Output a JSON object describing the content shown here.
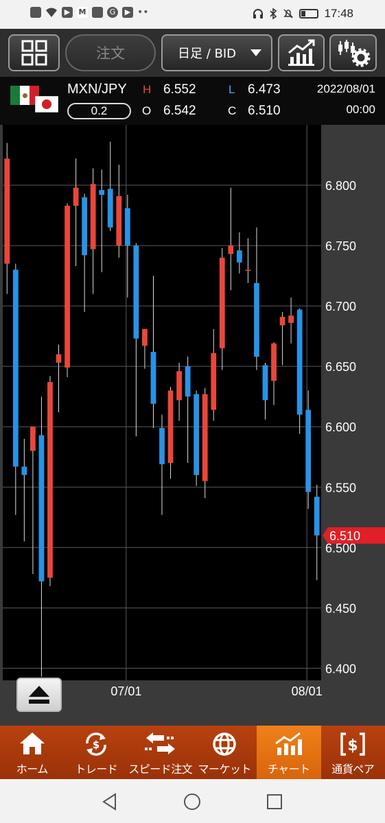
{
  "status_bar": {
    "time": "17:48",
    "icons": [
      "notification-icons",
      "headphones-icon",
      "bluetooth-icon",
      "mute-icon",
      "battery-icon"
    ]
  },
  "toolbar": {
    "grid_icon": "grid-menu-icon",
    "order_label": "注文",
    "period_label": "日足 / BID",
    "chart_icon": "chart-type-icon",
    "settings_icon": "indicator-settings-icon"
  },
  "info": {
    "pair": "MXN/JPY",
    "spread": "0.2",
    "high_label": "H",
    "high": "6.552",
    "open_label": "O",
    "open": "6.542",
    "low_label": "L",
    "low": "6.473",
    "close_label": "C",
    "close": "6.510",
    "date": "2022/08/01",
    "time": "00:00"
  },
  "colors": {
    "up": "#e9473b",
    "down": "#2893e6",
    "high_label": "#e9473b",
    "low_label": "#4aa8f0",
    "current_price": "#e11f26",
    "nav_bg": "#a8390c",
    "nav_active": "#ec7516"
  },
  "chart_data": {
    "type": "candlestick",
    "y_ticks": [
      "6.800",
      "6.750",
      "6.700",
      "6.650",
      "6.600",
      "6.550",
      "6.500",
      "6.450",
      "6.400"
    ],
    "ylim": [
      6.39,
      6.85
    ],
    "x_ticks": [
      {
        "label": "07/01",
        "index": 14
      },
      {
        "label": "08/01",
        "index": 35
      }
    ],
    "current_price": "6.510",
    "candles": [
      {
        "o": 6.735,
        "h": 6.835,
        "l": 6.71,
        "c": 6.822
      },
      {
        "o": 6.73,
        "h": 6.735,
        "l": 6.527,
        "c": 6.567
      },
      {
        "o": 6.567,
        "h": 6.59,
        "l": 6.505,
        "c": 6.56
      },
      {
        "o": 6.58,
        "h": 6.6,
        "l": 6.478,
        "c": 6.6
      },
      {
        "o": 6.593,
        "h": 6.625,
        "l": 6.393,
        "c": 6.472
      },
      {
        "o": 6.475,
        "h": 6.642,
        "l": 6.468,
        "c": 6.637
      },
      {
        "o": 6.653,
        "h": 6.668,
        "l": 6.612,
        "c": 6.66
      },
      {
        "o": 6.649,
        "h": 6.785,
        "l": 6.641,
        "c": 6.783
      },
      {
        "o": 6.783,
        "h": 6.822,
        "l": 6.733,
        "c": 6.798
      },
      {
        "o": 6.79,
        "h": 6.793,
        "l": 6.695,
        "c": 6.742
      },
      {
        "o": 6.747,
        "h": 6.814,
        "l": 6.71,
        "c": 6.801
      },
      {
        "o": 6.796,
        "h": 6.813,
        "l": 6.728,
        "c": 6.792
      },
      {
        "o": 6.797,
        "h": 6.836,
        "l": 6.762,
        "c": 6.765
      },
      {
        "o": 6.75,
        "h": 6.817,
        "l": 6.74,
        "c": 6.791
      },
      {
        "o": 6.781,
        "h": 6.792,
        "l": 6.707,
        "c": 6.75
      },
      {
        "o": 6.75,
        "h": 6.752,
        "l": 6.592,
        "c": 6.673
      },
      {
        "o": 6.667,
        "h": 6.68,
        "l": 6.648,
        "c": 6.681
      },
      {
        "o": 6.662,
        "h": 6.725,
        "l": 6.599,
        "c": 6.619
      },
      {
        "o": 6.599,
        "h": 6.61,
        "l": 6.527,
        "c": 6.569
      },
      {
        "o": 6.57,
        "h": 6.633,
        "l": 6.557,
        "c": 6.63
      },
      {
        "o": 6.622,
        "h": 6.653,
        "l": 6.605,
        "c": 6.646
      },
      {
        "o": 6.65,
        "h": 6.658,
        "l": 6.57,
        "c": 6.625
      },
      {
        "o": 6.627,
        "h": 6.63,
        "l": 6.551,
        "c": 6.56
      },
      {
        "o": 6.555,
        "h": 6.632,
        "l": 6.541,
        "c": 6.627
      },
      {
        "o": 6.614,
        "h": 6.681,
        "l": 6.605,
        "c": 6.661
      },
      {
        "o": 6.665,
        "h": 6.748,
        "l": 6.647,
        "c": 6.74
      },
      {
        "o": 6.743,
        "h": 6.798,
        "l": 6.713,
        "c": 6.75
      },
      {
        "o": 6.746,
        "h": 6.761,
        "l": 6.727,
        "c": 6.736
      },
      {
        "o": 6.73,
        "h": 6.756,
        "l": 6.719,
        "c": 6.73
      },
      {
        "o": 6.719,
        "h": 6.765,
        "l": 6.647,
        "c": 6.658
      },
      {
        "o": 6.651,
        "h": 6.653,
        "l": 6.606,
        "c": 6.622
      },
      {
        "o": 6.638,
        "h": 6.67,
        "l": 6.618,
        "c": 6.669
      },
      {
        "o": 6.684,
        "h": 6.695,
        "l": 6.651,
        "c": 6.691
      },
      {
        "o": 6.686,
        "h": 6.707,
        "l": 6.669,
        "c": 6.692
      },
      {
        "o": 6.697,
        "h": 6.698,
        "l": 6.594,
        "c": 6.61
      },
      {
        "o": 6.614,
        "h": 6.63,
        "l": 6.532,
        "c": 6.546
      },
      {
        "o": 6.542,
        "h": 6.552,
        "l": 6.473,
        "c": 6.51
      }
    ]
  },
  "bottom_nav": [
    {
      "label": "ホーム",
      "icon": "home-icon"
    },
    {
      "label": "トレード",
      "icon": "trade-icon"
    },
    {
      "label": "スピード注文",
      "icon": "speed-order-icon"
    },
    {
      "label": "マーケット",
      "icon": "market-icon"
    },
    {
      "label": "チャート",
      "icon": "chart-icon",
      "active": true
    },
    {
      "label": "通貨ペア",
      "icon": "currency-pair-icon"
    }
  ]
}
